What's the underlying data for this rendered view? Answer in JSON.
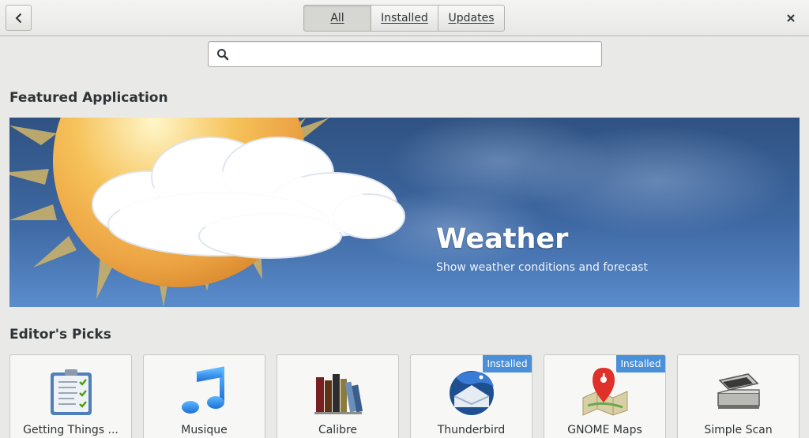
{
  "header": {
    "tabs": [
      {
        "label": "All",
        "active": true
      },
      {
        "label": "Installed",
        "active": false
      },
      {
        "label": "Updates",
        "active": false
      }
    ]
  },
  "search": {
    "placeholder": "",
    "value": ""
  },
  "featured": {
    "section_title": "Featured Application",
    "app_name": "Weather",
    "description": "Show weather conditions and forecast"
  },
  "picks": {
    "section_title": "Editor's Picks",
    "installed_label": "Installed",
    "apps": [
      {
        "name": "Getting Things ...",
        "installed": false,
        "icon": "getting-things-gnome-icon"
      },
      {
        "name": "Musique",
        "installed": false,
        "icon": "music-note-icon"
      },
      {
        "name": "Calibre",
        "installed": false,
        "icon": "books-icon"
      },
      {
        "name": "Thunderbird",
        "installed": true,
        "icon": "thunderbird-icon"
      },
      {
        "name": "GNOME Maps",
        "installed": true,
        "icon": "map-pin-icon"
      },
      {
        "name": "Simple Scan",
        "installed": false,
        "icon": "scanner-icon"
      }
    ]
  },
  "colors": {
    "accent": "#4a90d9",
    "banner_top": "#2f5282",
    "banner_bottom": "#5a8ccc"
  }
}
